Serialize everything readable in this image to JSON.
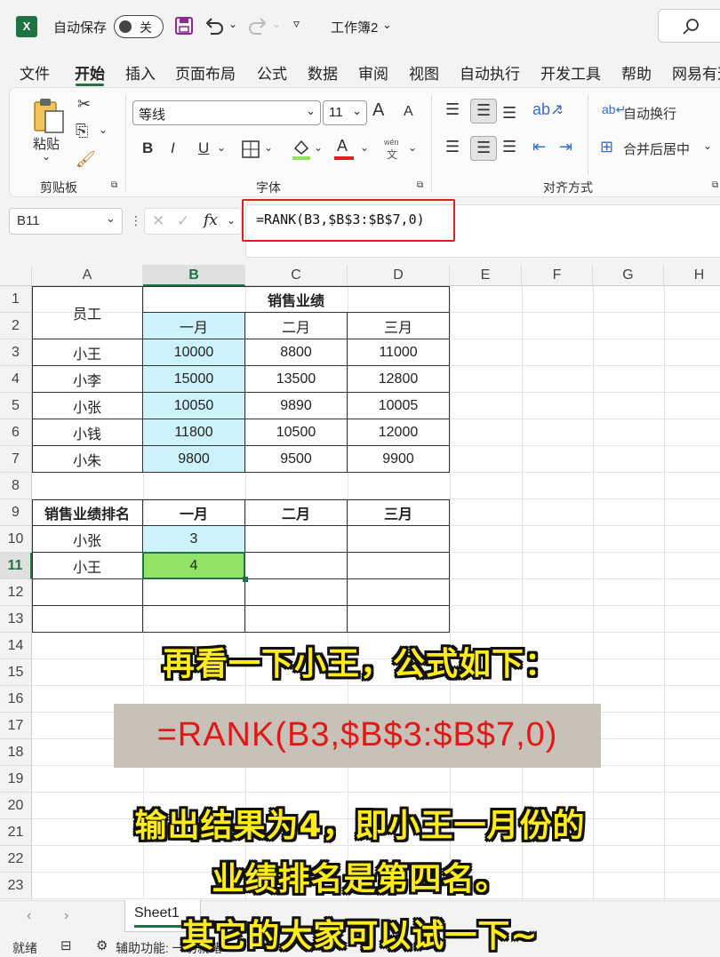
{
  "titlebar": {
    "app_icon": "X",
    "autosave_label": "自动保存",
    "autosave_state": "关",
    "workbook_name": "工作簿2",
    "search_icon": "search-icon"
  },
  "menu": {
    "tabs": [
      "文件",
      "开始",
      "插入",
      "页面布局",
      "公式",
      "数据",
      "审阅",
      "视图",
      "自动执行",
      "开发工具",
      "帮助",
      "网易有道"
    ],
    "active": "开始"
  },
  "ribbon": {
    "clipboard": {
      "paste_label": "粘贴",
      "group_label": "剪贴板"
    },
    "font": {
      "font_name": "等线",
      "font_size": "11",
      "grow": "A",
      "shrink": "A",
      "bold": "B",
      "italic": "I",
      "underline": "U",
      "font_color": "A",
      "phonetic_top": "wén",
      "phonetic_bottom": "文",
      "group_label": "字体"
    },
    "alignment": {
      "wrap_text": "自动换行",
      "merge_center": "合并后居中",
      "group_label": "对齐方式"
    }
  },
  "formula_bar": {
    "name_box": "B11",
    "fx": "fx",
    "formula": "=RANK(B3,$B$3:$B$7,0)"
  },
  "grid": {
    "columns": [
      "A",
      "B",
      "C",
      "D",
      "E",
      "F",
      "G",
      "H"
    ],
    "rows": [
      "1",
      "2",
      "3",
      "4",
      "5",
      "6",
      "7",
      "8",
      "9",
      "10",
      "11",
      "12",
      "13",
      "14",
      "15",
      "16",
      "17",
      "18",
      "19",
      "20",
      "21",
      "22",
      "23"
    ],
    "table1": {
      "header_a": "员工",
      "header_merged": "销售业绩",
      "months": [
        "一月",
        "二月",
        "三月"
      ],
      "data": [
        [
          "小王",
          "10000",
          "8800",
          "11000"
        ],
        [
          "小李",
          "15000",
          "13500",
          "12800"
        ],
        [
          "小张",
          "10050",
          "9890",
          "10005"
        ],
        [
          "小钱",
          "11800",
          "10500",
          "12000"
        ],
        [
          "小朱",
          "9800",
          "9500",
          "9900"
        ]
      ]
    },
    "table2": {
      "header": [
        "销售业绩排名",
        "一月",
        "二月",
        "三月"
      ],
      "rows": [
        [
          "小张",
          "3",
          "",
          ""
        ],
        [
          "小王",
          "4",
          "",
          ""
        ],
        [
          "",
          "",
          "",
          ""
        ],
        [
          "",
          "",
          "",
          ""
        ]
      ]
    }
  },
  "overlay": {
    "caption1": "再看一下小王，公式如下：",
    "formula": "=RANK(B3,$B$3:$B$7,0)",
    "caption2": "输出结果为4，即小王一月份的",
    "caption3": "业绩排名是第四名。",
    "caption4": "其它的大家可以试一下~"
  },
  "sheetbar": {
    "sheet_name": "Sheet1"
  },
  "statusbar": {
    "ready": "就绪",
    "accessibility": "辅助功能: 一切就绪"
  },
  "colors": {
    "accent": "#1f7244",
    "highlight_cyan": "#ccf3fb",
    "highlight_green": "#92e265",
    "formula_red": "#e01818",
    "caption_yellow": "#ffec1a"
  }
}
